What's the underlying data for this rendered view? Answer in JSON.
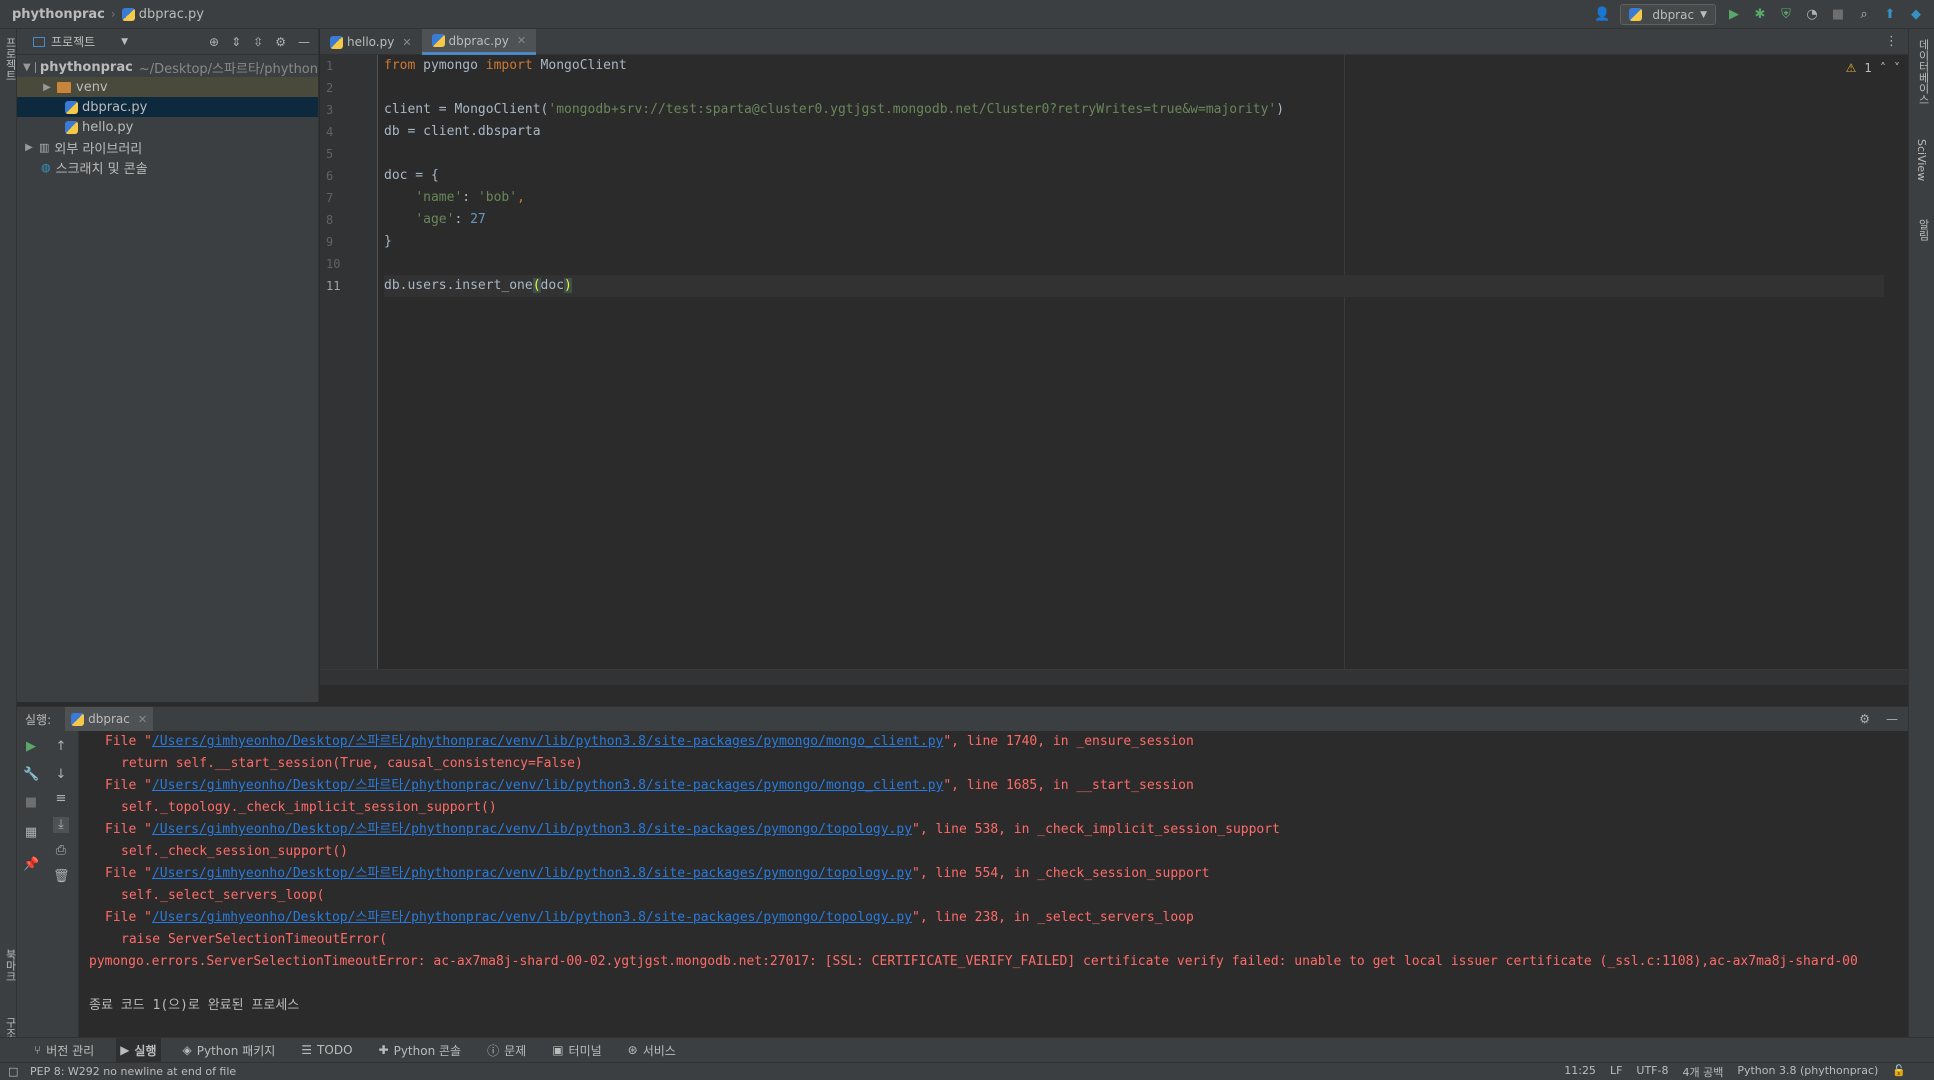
{
  "navbar": {
    "project": "phythonprac",
    "file": "dbprac.py",
    "run_config": "dbprac"
  },
  "left_strip": {
    "project_label": "프로젝트",
    "bookmarks_label": "북마크",
    "structure_label": "구조"
  },
  "right_strip": {
    "database_label": "데이터베이스",
    "sciview_label": "SciView",
    "notifications_label": "알림"
  },
  "project_panel": {
    "title": "프로젝트",
    "root_name": "phythonprac",
    "root_path": "~/Desktop/스파르타/phython",
    "items": [
      {
        "label": "venv"
      },
      {
        "label": "dbprac.py"
      },
      {
        "label": "hello.py"
      }
    ],
    "external_libraries": "외부 라이브러리",
    "scratches": "스크래치 및 콘솔"
  },
  "editor": {
    "tabs": [
      {
        "label": "hello.py"
      },
      {
        "label": "dbprac.py"
      }
    ],
    "inspection_count": "1",
    "line_numbers": [
      "1",
      "2",
      "3",
      "4",
      "5",
      "6",
      "7",
      "8",
      "9",
      "10",
      "11"
    ],
    "code": {
      "l1_from": "from",
      "l1_mod": " pymongo ",
      "l1_import": "import",
      "l1_rest": " MongoClient",
      "l3_pre": "client = MongoClient(",
      "l3_str": "'mongodb+srv://test:sparta@cluster0.ygtjgst.mongodb.net/Cluster0?retryWrites=true&w=majority'",
      "l3_post": ")",
      "l4": "db = client.dbsparta",
      "l6": "doc = {",
      "l7_key": "'name'",
      "l7_colon": ": ",
      "l7_val": "'bob'",
      "l7_comma": ",",
      "l8_key": "'age'",
      "l8_colon": ": ",
      "l8_val": "27",
      "l9": "}",
      "l11_pre": "db.users.insert_one",
      "l11_open": "(",
      "l11_arg": "doc",
      "l11_close": ")"
    }
  },
  "run_panel": {
    "label": "실행:",
    "tab": "dbprac",
    "console": {
      "file_prefix": "File \"",
      "f1_path": "/Users/gimhyeonho/Desktop/스파르타/phythonprac/venv/lib/python3.8/site-packages/pymongo/mongo_client.py",
      "f1_tail": "\", line 1740, in _ensure_session",
      "c1": "return self.__start_session(True, causal_consistency=False)",
      "f2_path": "/Users/gimhyeonho/Desktop/스파르타/phythonprac/venv/lib/python3.8/site-packages/pymongo/mongo_client.py",
      "f2_tail": "\", line 1685, in __start_session",
      "c2": "self._topology._check_implicit_session_support()",
      "f3_path": "/Users/gimhyeonho/Desktop/스파르타/phythonprac/venv/lib/python3.8/site-packages/pymongo/topology.py",
      "f3_tail": "\", line 538, in _check_implicit_session_support",
      "c3": "self._check_session_support()",
      "f4_path": "/Users/gimhyeonho/Desktop/스파르타/phythonprac/venv/lib/python3.8/site-packages/pymongo/topology.py",
      "f4_tail": "\", line 554, in _check_session_support",
      "c4": "self._select_servers_loop(",
      "f5_path": "/Users/gimhyeonho/Desktop/스파르타/phythonprac/venv/lib/python3.8/site-packages/pymongo/topology.py",
      "f5_tail": "\", line 238, in _select_servers_loop",
      "c5": "raise ServerSelectionTimeoutError(",
      "error": "pymongo.errors.ServerSelectionTimeoutError: ac-ax7ma8j-shard-00-02.ygtjgst.mongodb.net:27017: [SSL: CERTIFICATE_VERIFY_FAILED] certificate verify failed: unable to get local issuer certificate (_ssl.c:1108),ac-ax7ma8j-shard-00",
      "exit": "종료 코드 1(으)로 완료된 프로세스"
    }
  },
  "bottom_tools": [
    {
      "icon": "branch-icon",
      "label": "버전 관리"
    },
    {
      "icon": "play-icon",
      "label": "실행"
    },
    {
      "icon": "package-icon",
      "label": "Python 패키지"
    },
    {
      "icon": "list-icon",
      "label": "TODO"
    },
    {
      "icon": "python-icon",
      "label": "Python 콘솔"
    },
    {
      "icon": "info-icon",
      "label": "문제"
    },
    {
      "icon": "terminal-icon",
      "label": "터미널"
    },
    {
      "icon": "services-icon",
      "label": "서비스"
    }
  ],
  "statusbar": {
    "message": "PEP 8: W292 no newline at end of file",
    "position": "11:25",
    "line_sep": "LF",
    "encoding": "UTF-8",
    "indent": "4개 공백",
    "interpreter": "Python 3.8 (phythonprac)"
  },
  "colors": {
    "accent": "#4a88c7",
    "error": "#ff6b68",
    "link": "#287bde",
    "keyword": "#cc7832",
    "string": "#6a8759",
    "number": "#6897bb"
  }
}
